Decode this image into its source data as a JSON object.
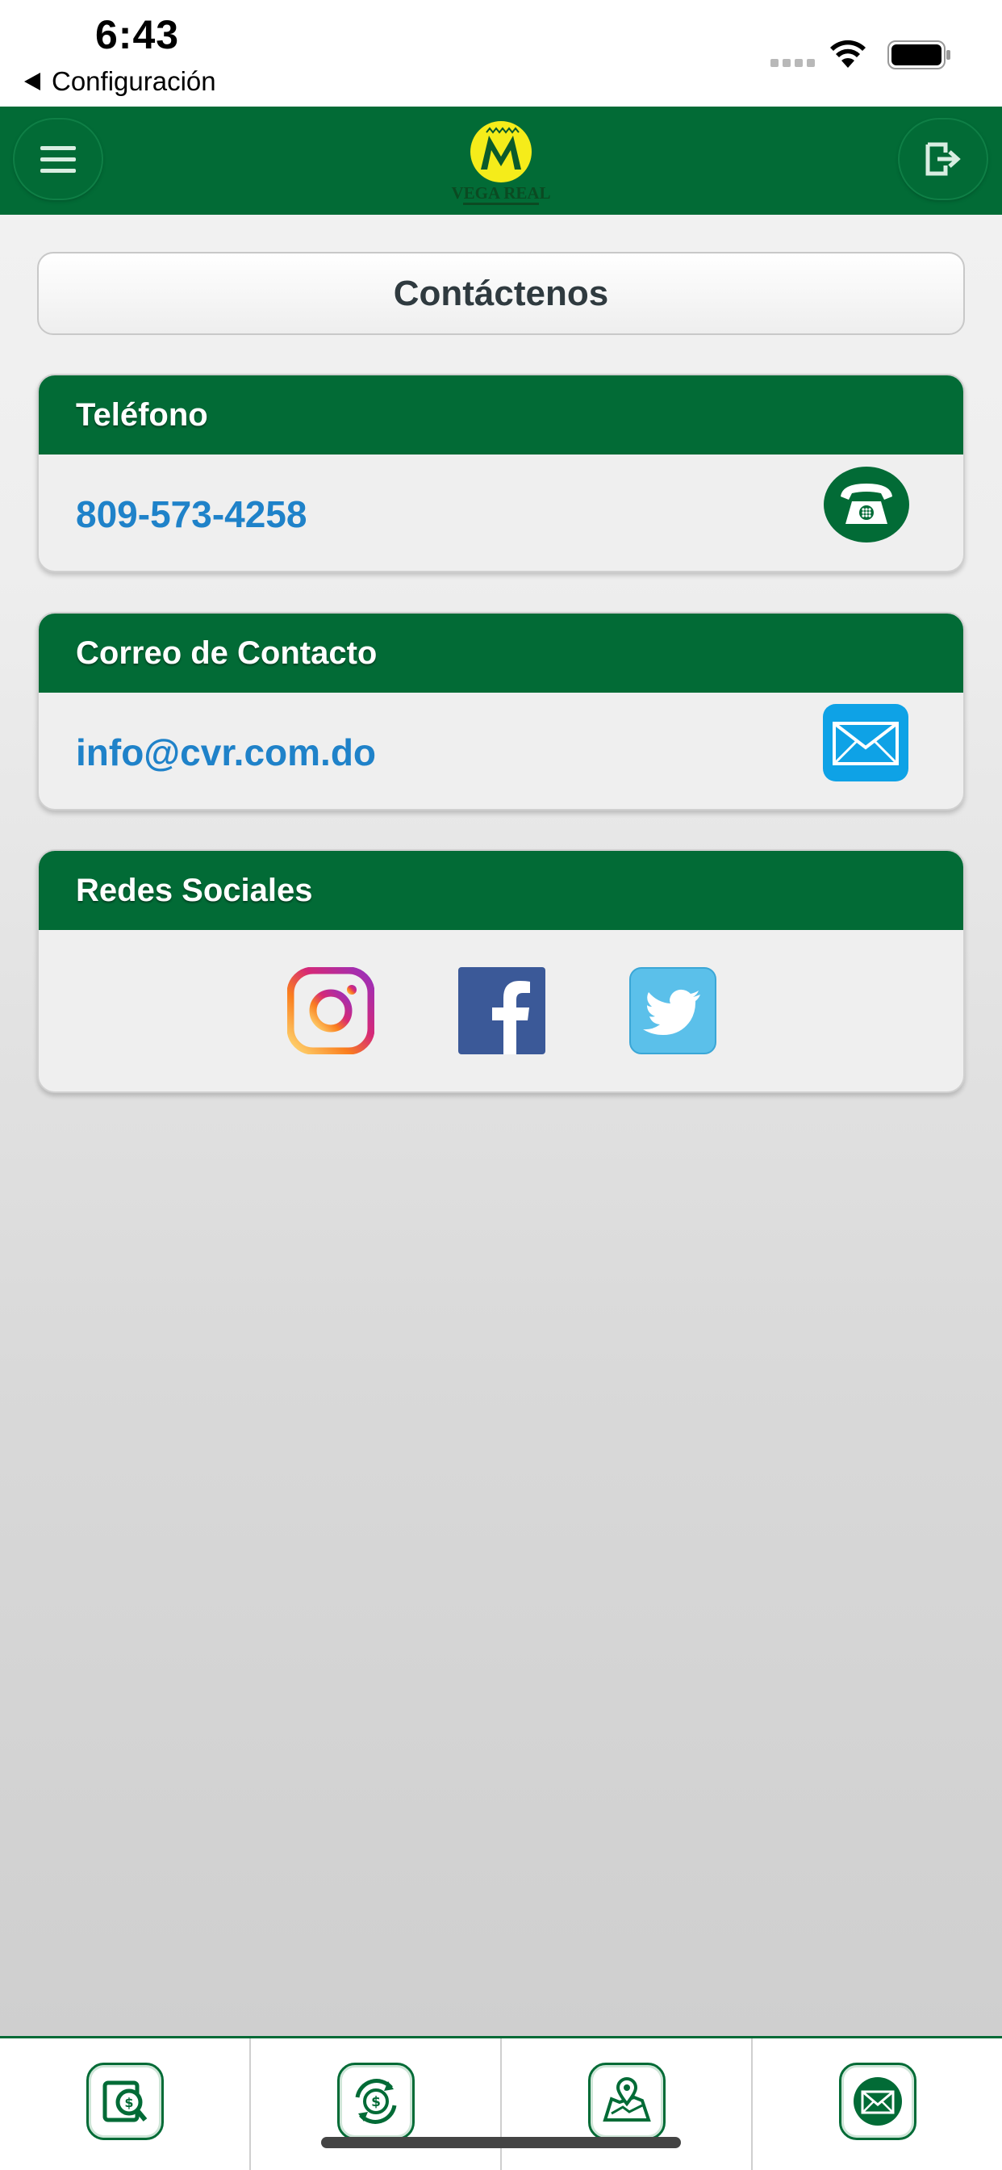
{
  "status_bar": {
    "time": "6:43",
    "back_label": "Configuración"
  },
  "header": {
    "menu_icon": "hamburger-menu-icon",
    "logout_icon": "logout-icon",
    "logo_text": "VEGA REAL"
  },
  "page": {
    "title": "Contáctenos"
  },
  "phone_card": {
    "heading": "Teléfono",
    "value": "809-573-4258",
    "icon": "telephone-icon"
  },
  "mail_card": {
    "heading": "Correo de Contacto",
    "value": "info@cvr.com.do",
    "icon": "mail-icon"
  },
  "social_card": {
    "heading": "Redes Sociales",
    "networks": [
      "instagram-icon",
      "facebook-icon",
      "twitter-icon"
    ]
  },
  "tabbar": {
    "tabs": [
      "balance-search-icon",
      "money-exchange-icon",
      "map-location-icon",
      "mail-icon"
    ]
  },
  "colors": {
    "brand_green": "#026b36",
    "link_blue": "#1f82c9",
    "mail_blue": "#0ea2e6",
    "logo_yellow": "#f5ec1a"
  }
}
